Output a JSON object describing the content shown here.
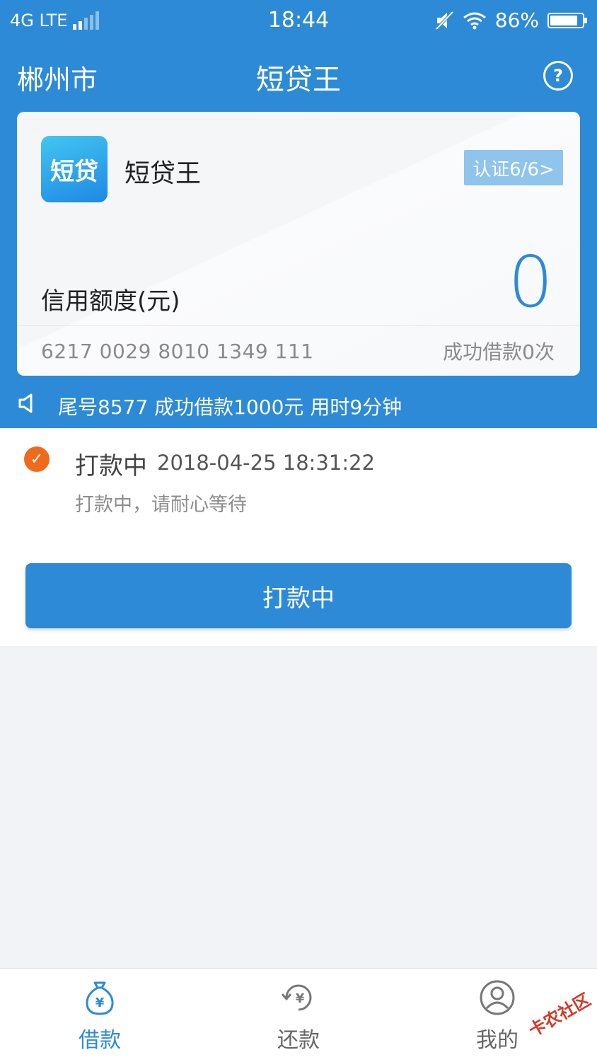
{
  "status_bar": {
    "network": "4G LTE",
    "time": "18:44",
    "battery": "86%",
    "battery_level": 0.86
  },
  "nav": {
    "city": "郴州市",
    "title": "短贷王",
    "help_icon": "question-circle-icon"
  },
  "card": {
    "logo_text": "短贷",
    "app_name": "短贷王",
    "certification": "认证6/6>",
    "credit_label": "信用额度(元)",
    "credit_amount": "0",
    "bank_card": "6217 0029 8010 1349 111",
    "success_times": "成功借款0次"
  },
  "notice": {
    "text": "尾号8577 成功借款1000元 用时9分钟"
  },
  "loan_status": {
    "title": "打款中",
    "timestamp": "2018-04-25 18:31:22",
    "description": "打款中，请耐心等待",
    "button_label": "打款中"
  },
  "tabbar": {
    "tabs": [
      {
        "label": "借款",
        "icon": "money-bag-icon"
      },
      {
        "label": "还款",
        "icon": "refresh-yen-icon"
      },
      {
        "label": "我的",
        "icon": "user-icon"
      }
    ]
  },
  "watermark": "卡农社区",
  "colors": {
    "primary": "#2d8ad6",
    "accent_orange": "#ef6a1c",
    "cert_badge": "#8fc4ec"
  }
}
